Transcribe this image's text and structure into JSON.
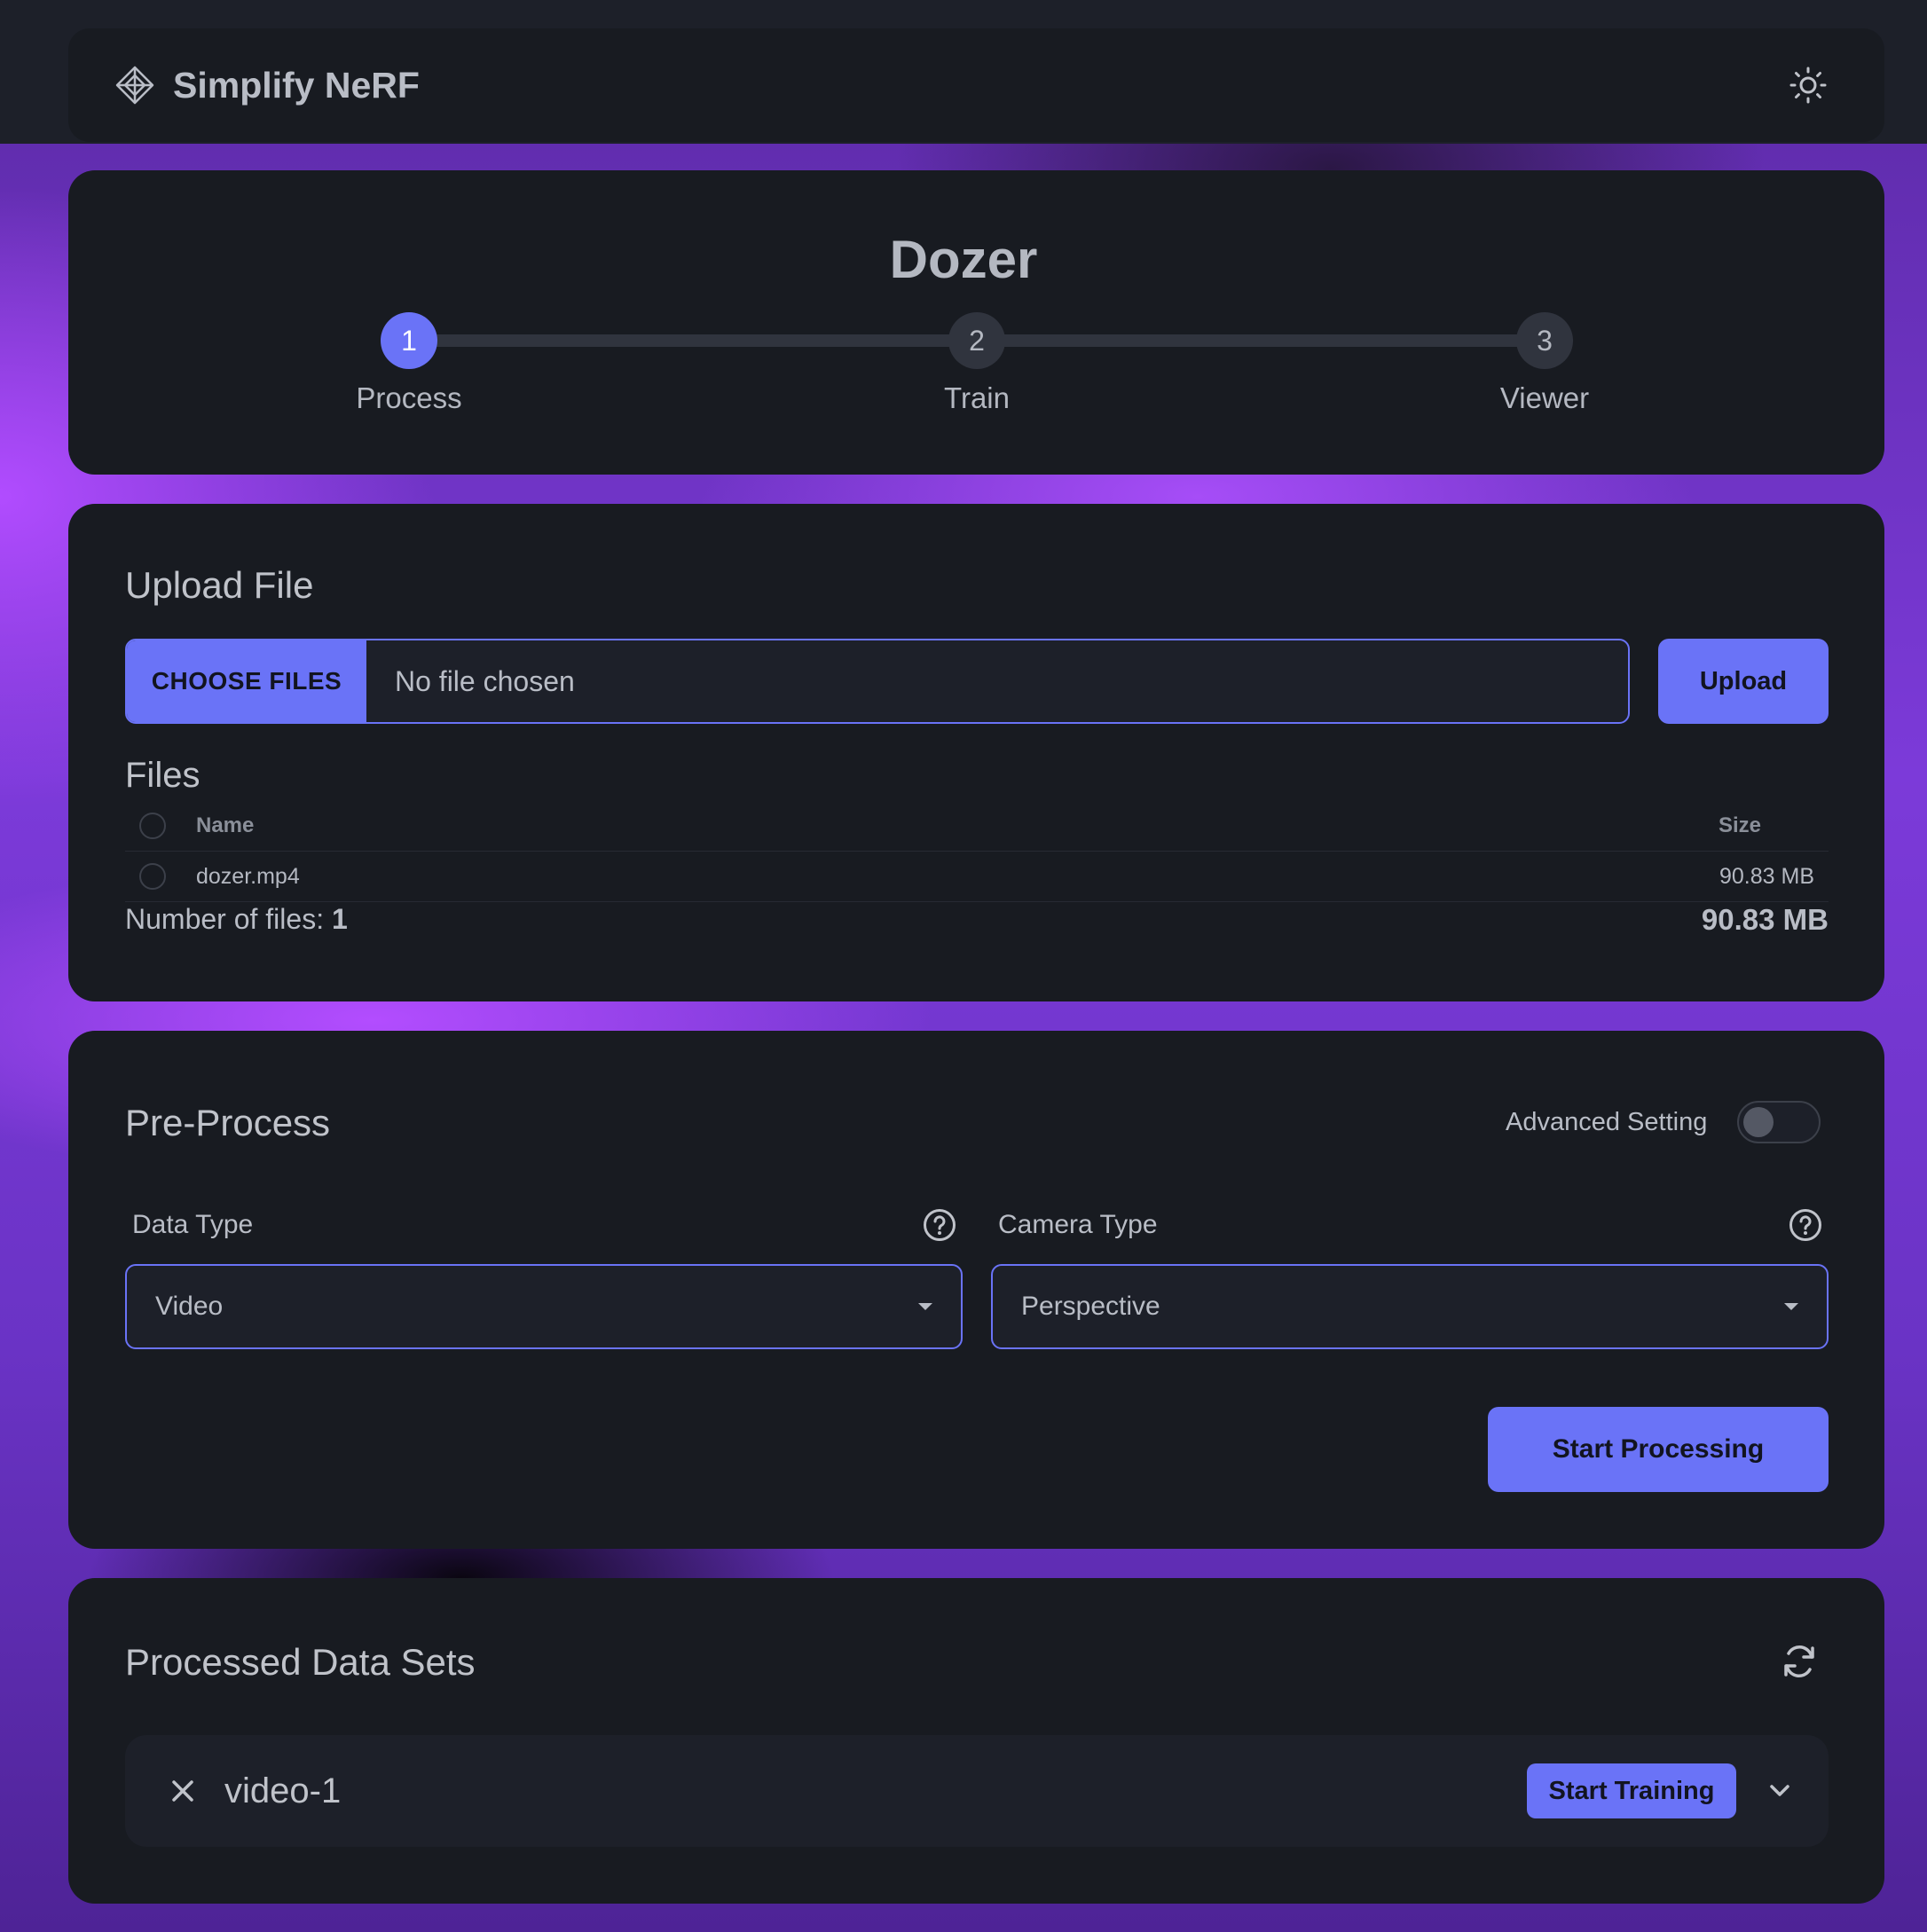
{
  "app": {
    "name": "Simplify NeRF"
  },
  "project": {
    "title": "Dozer"
  },
  "steps": [
    {
      "number": "1",
      "label": "Process",
      "active": true
    },
    {
      "number": "2",
      "label": "Train",
      "active": false
    },
    {
      "number": "3",
      "label": "Viewer",
      "active": false
    }
  ],
  "upload": {
    "title": "Upload File",
    "choose_label": "CHOOSE FILES",
    "no_file_text": "No file chosen",
    "upload_label": "Upload"
  },
  "files": {
    "title": "Files",
    "columns": {
      "name": "Name",
      "size": "Size"
    },
    "rows": [
      {
        "name": "dozer.mp4",
        "size": "90.83 MB"
      }
    ],
    "count_label": "Number of files:",
    "count": "1",
    "total_size": "90.83 MB"
  },
  "preprocess": {
    "title": "Pre-Process",
    "advanced_label": "Advanced Setting",
    "advanced_enabled": false,
    "data_type": {
      "label": "Data Type",
      "value": "Video"
    },
    "camera_type": {
      "label": "Camera Type",
      "value": "Perspective"
    },
    "start_label": "Start Processing"
  },
  "datasets": {
    "title": "Processed Data Sets",
    "items": [
      {
        "name": "video-1",
        "action_label": "Start Training"
      }
    ]
  },
  "colors": {
    "accent": "#6a73f7",
    "card": "#181b21",
    "field": "#1d2029"
  },
  "icons": {
    "logo": "diamond-logo-icon",
    "theme": "sun-icon",
    "help": "question-circle-icon",
    "refresh": "refresh-icon",
    "close": "close-icon",
    "expand": "chevron-down-icon"
  }
}
